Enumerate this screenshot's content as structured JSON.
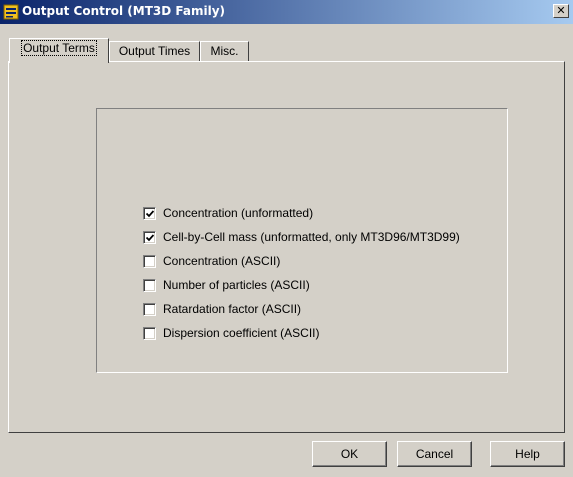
{
  "window": {
    "title": "Output Control (MT3D Family)",
    "close_glyph": "✕"
  },
  "tabs": [
    {
      "label": "Output Terms",
      "active": true
    },
    {
      "label": "Output Times",
      "active": false
    },
    {
      "label": "Misc.",
      "active": false
    }
  ],
  "options": [
    {
      "label": "Concentration (unformatted)",
      "checked": true
    },
    {
      "label": "Cell-by-Cell mass (unformatted, only MT3D96/MT3D99)",
      "checked": true
    },
    {
      "label": "Concentration (ASCII)",
      "checked": false
    },
    {
      "label": "Number of particles (ASCII)",
      "checked": false
    },
    {
      "label": "Ratardation factor (ASCII)",
      "checked": false
    },
    {
      "label": "Dispersion coefficient (ASCII)",
      "checked": false
    }
  ],
  "buttons": {
    "ok": "OK",
    "cancel": "Cancel",
    "help": "Help"
  },
  "colors": {
    "titlebar_start": "#0a246a",
    "titlebar_end": "#a6caf0",
    "face": "#d4d0c8"
  },
  "icons": {
    "title": "form-icon",
    "close": "close-icon",
    "check": "checkmark-icon"
  }
}
